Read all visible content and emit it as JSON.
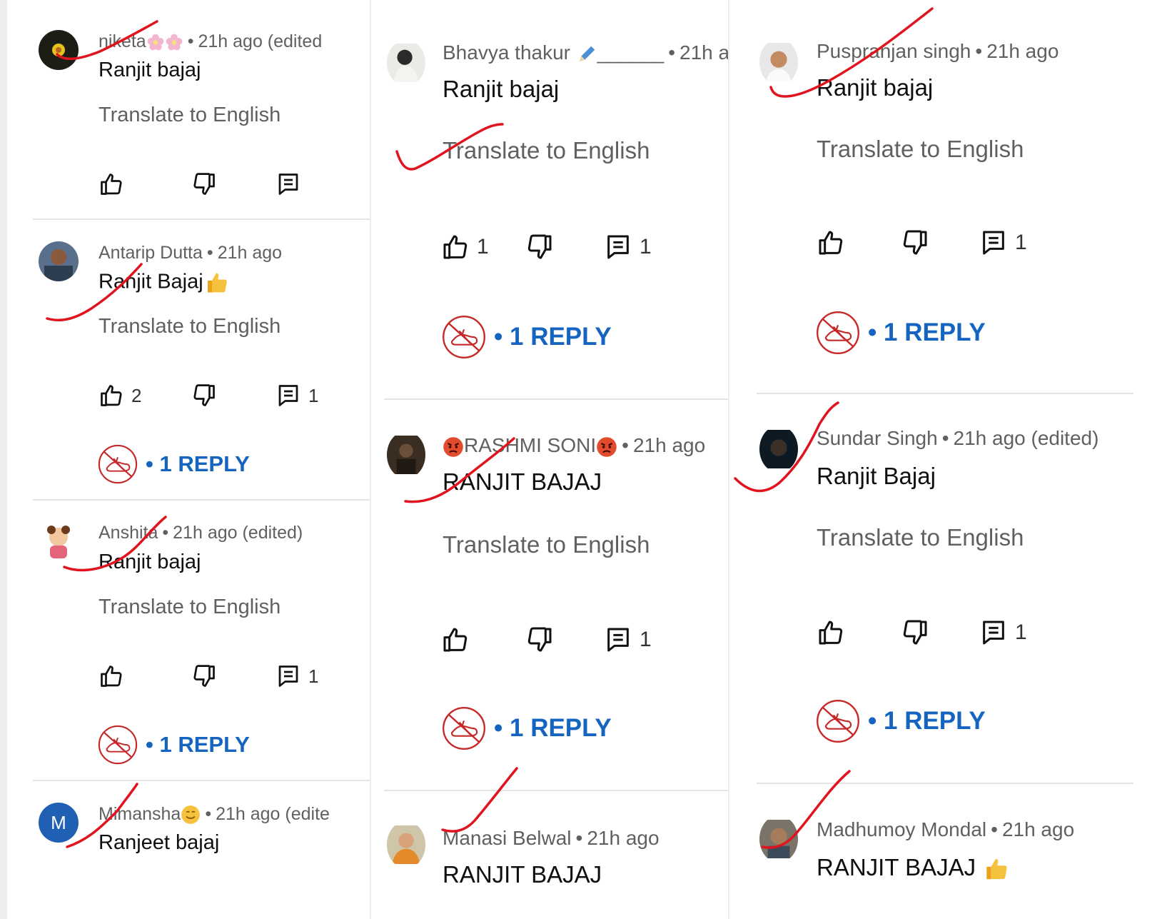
{
  "comments": [
    {
      "author": "niketa",
      "time": "21h ago (edited",
      "body": "Ranjit bajaj",
      "translate": "Translate to English",
      "likes": "",
      "replies_count": "",
      "reply_label": ""
    },
    {
      "author": "Antarip Dutta",
      "time": "21h ago",
      "body": "Ranjit Bajaj",
      "translate": "Translate to English",
      "likes": "2",
      "replies_count": "1",
      "reply_label": "1 REPLY"
    },
    {
      "author": "Anshita",
      "time": "21h ago (edited)",
      "body": "Ranjit bajaj",
      "translate": "Translate to English",
      "likes": "",
      "replies_count": "1",
      "reply_label": "1 REPLY"
    },
    {
      "author": "Mimansha",
      "time": "21h ago (edite",
      "body": "Ranjeet bajaj",
      "avatar_letter": "M"
    },
    {
      "author": "Bhavya thakur",
      "author_suffix": "______",
      "time": "21h ag",
      "body": "Ranjit bajaj",
      "translate": "Translate to English",
      "likes": "1",
      "replies_count": "1",
      "reply_label": "1 REPLY"
    },
    {
      "author": "RASHMI SONI",
      "time": "21h ago",
      "body": "RANJIT BAJAJ",
      "translate": "Translate to English",
      "likes": "",
      "replies_count": "1",
      "reply_label": "1 REPLY"
    },
    {
      "author": "Manasi Belwal",
      "time": "21h ago",
      "body": "RANJIT BAJAJ"
    },
    {
      "author": "Puspranjan singh",
      "time": "21h ago",
      "body": "Ranjit bajaj",
      "translate": "Translate to English",
      "likes": "",
      "replies_count": "1",
      "reply_label": "1 REPLY"
    },
    {
      "author": "Sundar Singh",
      "time": "21h ago (edited)",
      "body": "Ranjit Bajaj",
      "translate": "Translate to English",
      "likes": "",
      "replies_count": "1",
      "reply_label": "1 REPLY"
    },
    {
      "author": "Madhumoy Mondal",
      "time": "21h ago",
      "body": "RANJIT BAJAJ"
    }
  ],
  "separator": "•",
  "icons": [
    "like-icon",
    "dislike-icon",
    "reply-icon",
    "creator-heart-icon",
    "flower-emoji",
    "thumbs-up-emoji",
    "smile-emoji",
    "angry-emoji",
    "pencil-emoji"
  ],
  "colors": {
    "reply_link": "#1565c0",
    "meta_text": "#606060",
    "annotation": "#e0141e",
    "creator_icon": "#c62828"
  }
}
